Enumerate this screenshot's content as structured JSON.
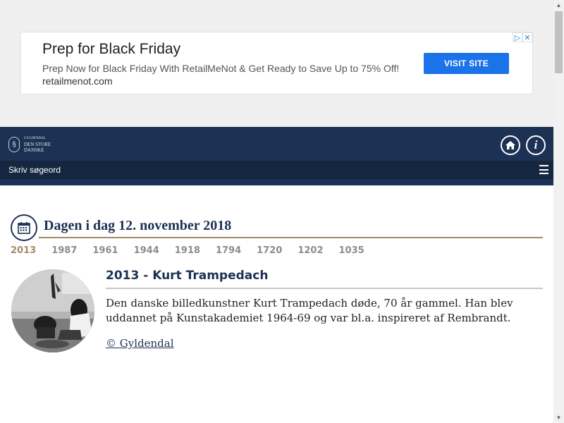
{
  "ad": {
    "title": "Prep for Black Friday",
    "description": "Prep Now for Black Friday With RetailMeNot & Get Ready to Save Up to 75% Off!",
    "domain": "retailmenot.com",
    "button_label": "VISIT SITE",
    "adchoices_icon": "adchoices-icon",
    "close_icon": "close-icon"
  },
  "header": {
    "logo": {
      "line1": "GYLDENDAL",
      "line2": "DEN STORE",
      "line3": "DANSKE"
    },
    "home_icon": "home-icon",
    "info_icon": "info-icon",
    "info_glyph": "i"
  },
  "search": {
    "placeholder": "Skriv søgeord",
    "menu_icon": "hamburger-menu-icon"
  },
  "main": {
    "calendar_icon": "calendar-icon",
    "title": "Dagen i dag 12. november 2018",
    "years": [
      "2013",
      "1987",
      "1961",
      "1944",
      "1918",
      "1794",
      "1720",
      "1202",
      "1035"
    ],
    "active_year": "2013",
    "entry": {
      "title": "2013 - Kurt Trampedach",
      "body": "Den danske billedkunstner Kurt Trampedach døde, 70 år gammel. Han blev uddannet på Kunstakademiet 1964-69 og var bl.a. inspireret af Rembrandt.",
      "credit": "© Gyldendal"
    }
  },
  "colors": {
    "navy": "#1c3153",
    "navy_dark": "#152640",
    "gold": "#a48a69",
    "ad_button": "#1a73e8"
  }
}
